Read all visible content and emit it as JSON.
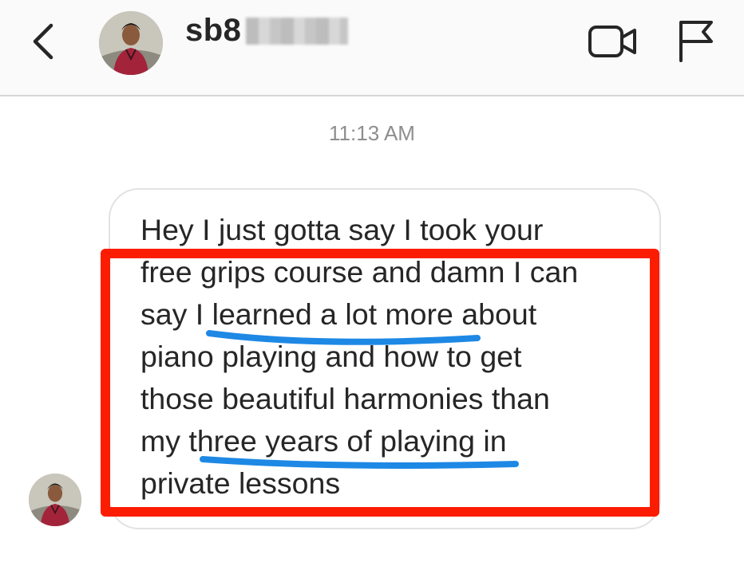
{
  "header": {
    "username": "sb8",
    "username_suffix": "redacted",
    "back_icon": "chevron-left-icon",
    "video_icon": "video-camera-icon",
    "flag_icon": "flag-icon"
  },
  "conversation": {
    "timestamp": "11:13 AM",
    "message_lines": [
      "Hey I just gotta say I took your",
      "free grips course and damn I can",
      "say I learned a lot more about",
      "piano playing and how to get",
      "those beautiful harmonies than",
      "my three years of playing in",
      "private lessons"
    ]
  },
  "annotations": {
    "box_color": "#fb1c02",
    "underline_color": "#1e88e5",
    "underlined_phrases": [
      "learned a lot more",
      "three years of playing"
    ]
  }
}
